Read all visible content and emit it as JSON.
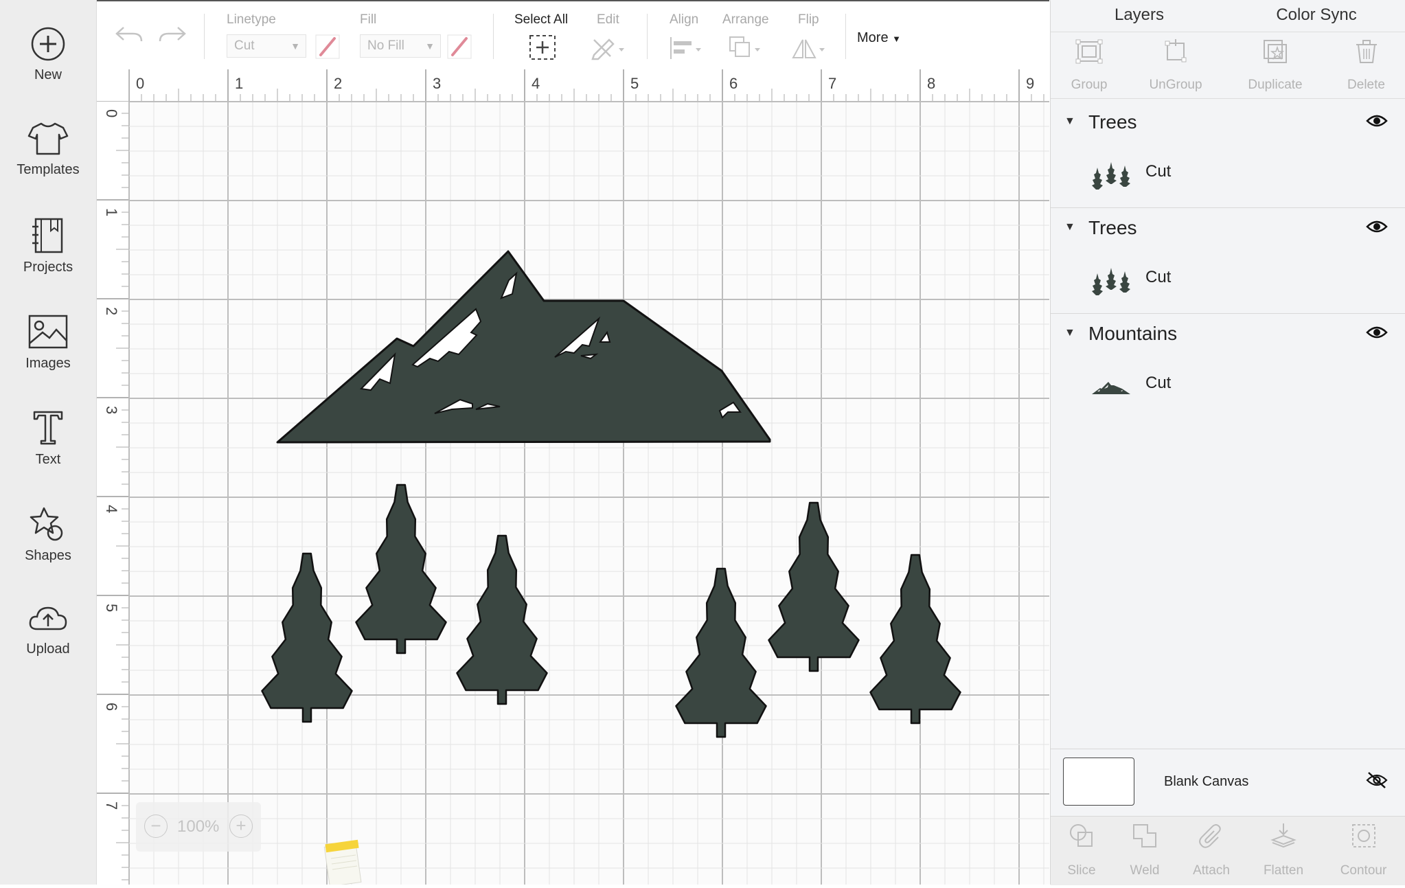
{
  "sidebar": {
    "items": [
      {
        "label": "New",
        "icon": "plus-circle-icon"
      },
      {
        "label": "Templates",
        "icon": "tshirt-icon"
      },
      {
        "label": "Projects",
        "icon": "notebook-icon"
      },
      {
        "label": "Images",
        "icon": "image-icon"
      },
      {
        "label": "Text",
        "icon": "text-t-icon"
      },
      {
        "label": "Shapes",
        "icon": "shapes-icon"
      },
      {
        "label": "Upload",
        "icon": "cloud-upload-icon"
      }
    ]
  },
  "toolbar": {
    "linetype_label": "Linetype",
    "linetype_value": "Cut",
    "fill_label": "Fill",
    "fill_value": "No Fill",
    "select_all_label": "Select All",
    "edit_label": "Edit",
    "align_label": "Align",
    "arrange_label": "Arrange",
    "flip_label": "Flip",
    "more_label": "More"
  },
  "ruler": {
    "x_ticks": [
      "0",
      "1",
      "2",
      "3",
      "4",
      "5",
      "6",
      "7",
      "8",
      "9"
    ],
    "y_ticks": [
      "0",
      "1",
      "2",
      "3",
      "4",
      "5",
      "6",
      "7"
    ]
  },
  "zoom": {
    "value": "100%"
  },
  "panel": {
    "tabs": [
      "Layers",
      "Color Sync"
    ],
    "actions": [
      "Group",
      "UnGroup",
      "Duplicate",
      "Delete"
    ],
    "groups": [
      {
        "name": "Trees",
        "layer": "Cut"
      },
      {
        "name": "Trees",
        "layer": "Cut"
      },
      {
        "name": "Mountains",
        "layer": "Cut"
      }
    ],
    "blank_canvas": "Blank Canvas",
    "bottom_actions": [
      "Slice",
      "Weld",
      "Attach",
      "Flatten",
      "Contour"
    ]
  },
  "colors": {
    "shape_fill": "#3a4641",
    "accent": "#e08a98"
  }
}
